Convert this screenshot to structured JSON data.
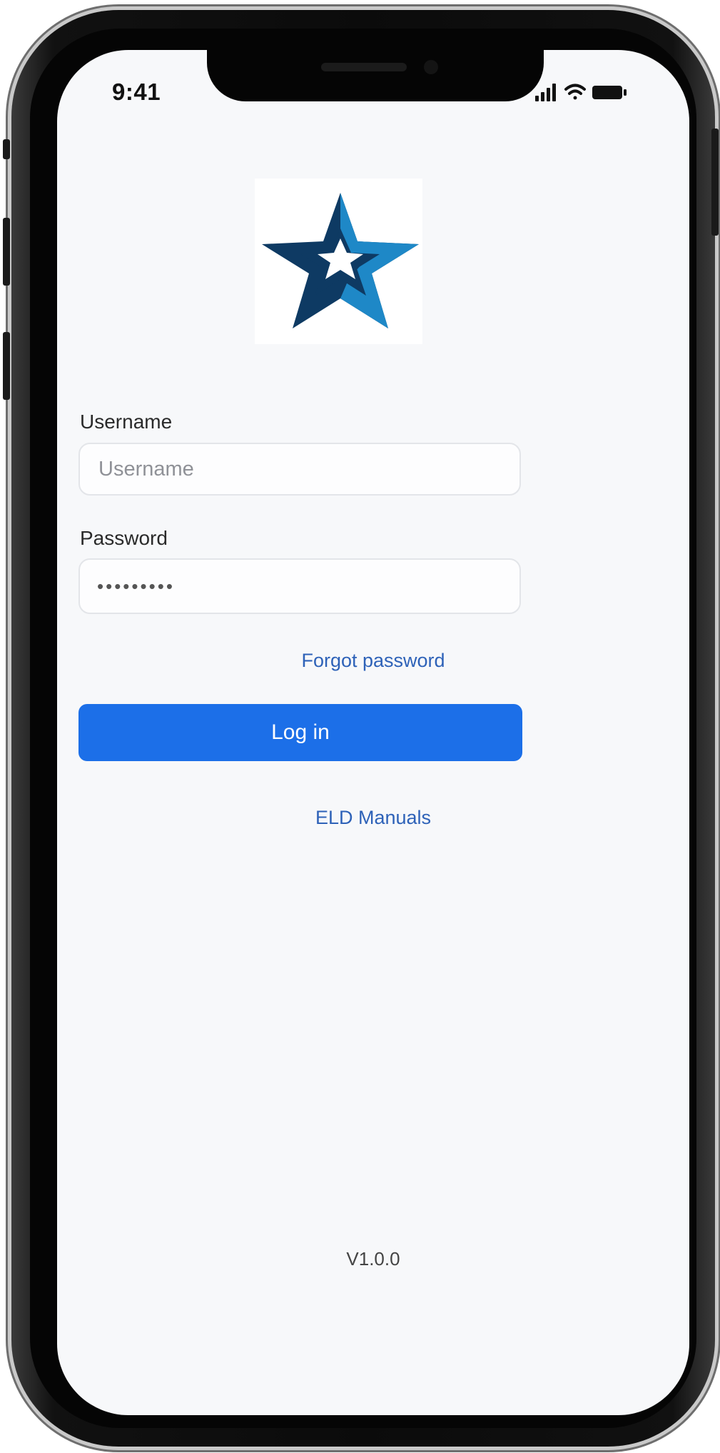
{
  "status_bar": {
    "time": "9:41",
    "icons": [
      "signal-icon",
      "wifi-icon",
      "battery-icon"
    ]
  },
  "logo": {
    "icon": "star-logo-icon",
    "colors": [
      "#0e3a63",
      "#1e88c7",
      "#ffffff"
    ]
  },
  "form": {
    "username_label": "Username",
    "username_placeholder": "Username",
    "username_value": "",
    "password_label": "Password",
    "password_value": "•••••••••",
    "forgot_link": "Forgot password",
    "login_button": "Log in",
    "manuals_link": "ELD Manuals"
  },
  "footer": {
    "version": "V1.0.0"
  },
  "theme": {
    "accent": "#1c6fe8",
    "link": "#2e62b8",
    "background": "#f7f8fa"
  }
}
